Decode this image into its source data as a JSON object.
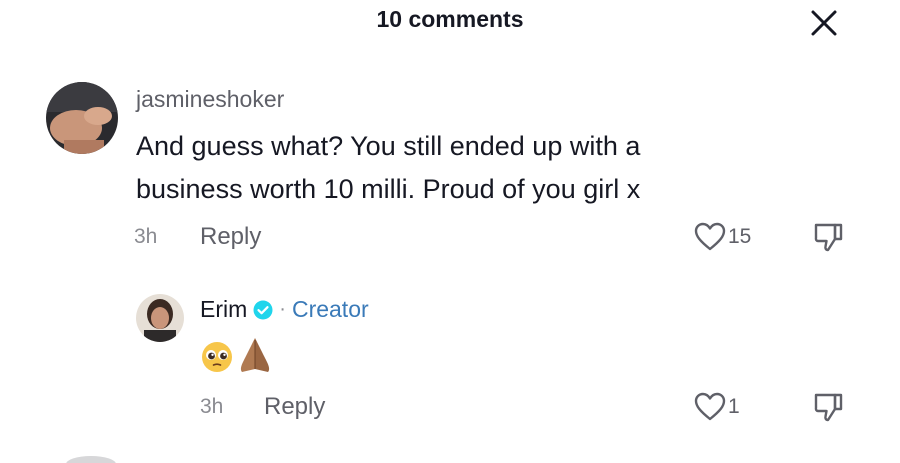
{
  "header": {
    "title": "10 comments",
    "close_icon": "close-icon"
  },
  "comments": [
    {
      "username": "jasmineshoker",
      "text_line1": "And guess what? You still ended up with a",
      "text_line2": "business worth 10 milli. Proud of you girl x",
      "time": "3h",
      "reply_label": "Reply",
      "likes": "15"
    }
  ],
  "replies": [
    {
      "username": "Erim",
      "separator": "·",
      "badge": "Creator",
      "emojis": [
        "pleading-face-emoji",
        "folded-hands-emoji"
      ],
      "time": "3h",
      "reply_label": "Reply",
      "likes": "1"
    }
  ],
  "colors": {
    "text_primary": "#161823",
    "text_secondary": "#5f6068",
    "text_muted": "#8a8b91",
    "verified": "#20d5ec",
    "creator_badge": "#3a7ab8"
  }
}
